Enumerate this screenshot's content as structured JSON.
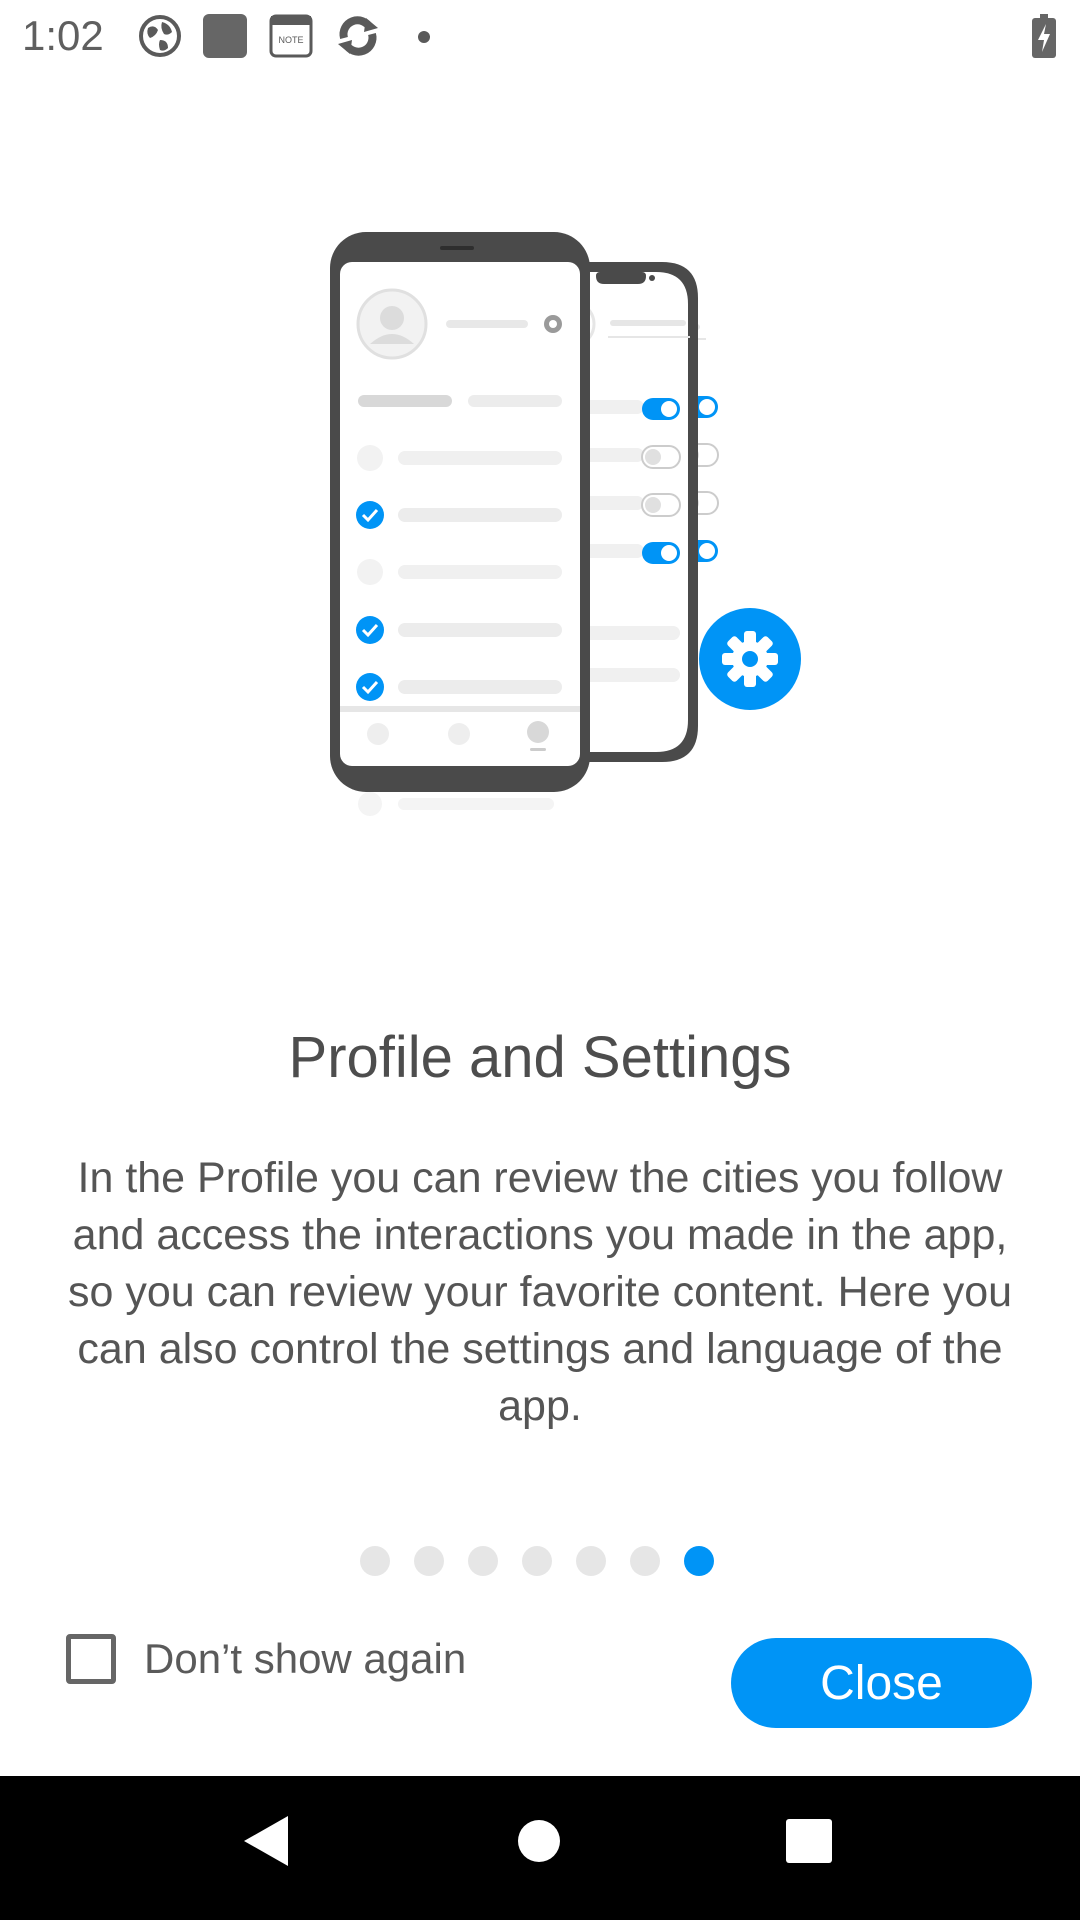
{
  "status_bar": {
    "time": "1:02",
    "icons": [
      "globe-icon",
      "app-square-icon",
      "note-icon",
      "sync-icon",
      "dot-icon",
      "battery-charging-icon"
    ],
    "note_icon_text": "NOTE"
  },
  "onboarding": {
    "title": "Profile and Settings",
    "description": "In the Profile you can review the cities you follow and access the interactions you made in the app, so you can review your favorite content. Here you can also control the settings and language of the app.",
    "page_count": 7,
    "current_page": 7,
    "dont_show_label": "Don’t show again",
    "dont_show_checked": false,
    "close_label": "Close"
  },
  "colors": {
    "accent": "#0094f6",
    "text": "#4d4d4d",
    "nav_bar": "#000000"
  },
  "nav_bar": {
    "icons": [
      "back-icon",
      "home-icon",
      "recents-icon"
    ]
  }
}
